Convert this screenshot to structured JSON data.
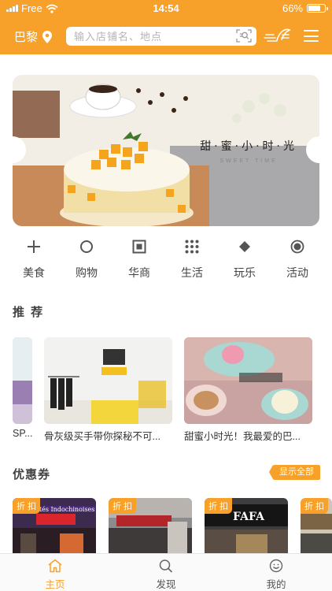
{
  "status_bar": {
    "carrier": "Free",
    "time": "14:54",
    "battery": "66%",
    "battery_level": 0.66
  },
  "nav": {
    "city": "巴黎",
    "search_placeholder": "输入店铺名、地点"
  },
  "banner": {
    "title": "甜·蜜·小·时·光",
    "subtitle": "SWEET TIME"
  },
  "categories": [
    {
      "label": "美食",
      "icon": "plus-icon"
    },
    {
      "label": "购物",
      "icon": "circle-icon"
    },
    {
      "label": "华商",
      "icon": "square-icon"
    },
    {
      "label": "生活",
      "icon": "grid-dots-icon"
    },
    {
      "label": "玩乐",
      "icon": "diamond-icon"
    },
    {
      "label": "活动",
      "icon": "radio-icon"
    }
  ],
  "recommend": {
    "title": "推 荐",
    "items": [
      {
        "text": "SP..."
      },
      {
        "text": "骨灰级买手带你探秘不可..."
      },
      {
        "text": "甜蜜小时光！我最爱的巴..."
      }
    ]
  },
  "coupons": {
    "title": "优惠券",
    "show_all": "显示全部",
    "items": [
      {
        "tag": "折 扣",
        "sign": "Spécialités Indochinoises"
      },
      {
        "tag": "折 扣",
        "sign": ""
      },
      {
        "tag": "折 扣",
        "sign": "FAFA"
      },
      {
        "tag": "折 扣",
        "sign": ""
      }
    ]
  },
  "tabbar": [
    {
      "label": "主页",
      "icon": "home-icon",
      "active": true
    },
    {
      "label": "发现",
      "icon": "search-icon",
      "active": false
    },
    {
      "label": "我的",
      "icon": "smiley-icon",
      "active": false
    }
  ],
  "colors": {
    "brand": "#f7a12a",
    "text": "#333333",
    "tabbar_bg": "#fafafa"
  }
}
